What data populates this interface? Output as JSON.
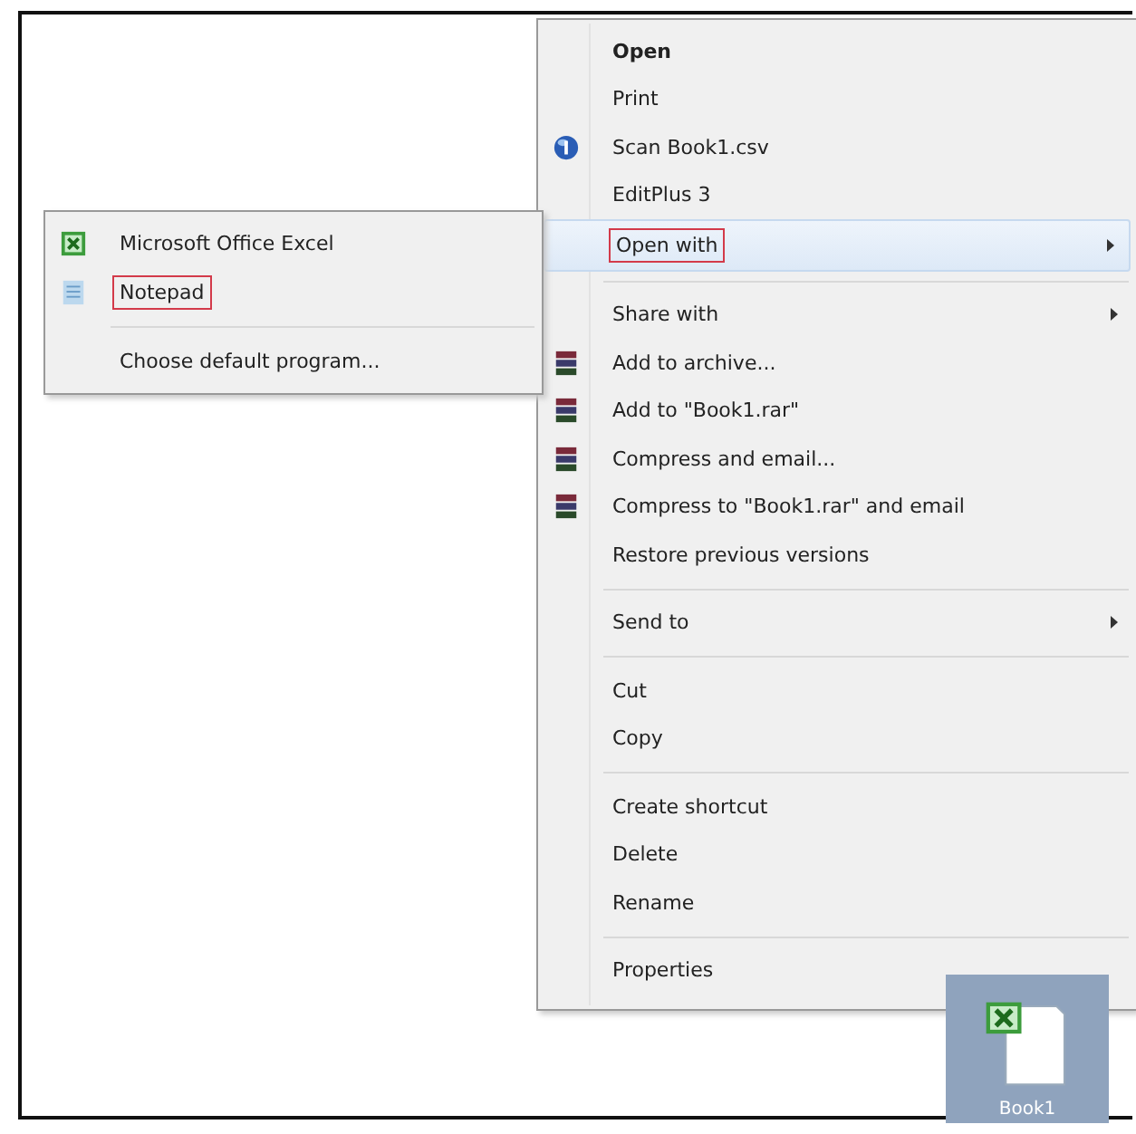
{
  "context_menu": {
    "items": [
      {
        "kind": "plain",
        "label": "Open",
        "bold": true
      },
      {
        "kind": "plain",
        "label": "Print"
      },
      {
        "kind": "scan",
        "label": "Scan Book1.csv"
      },
      {
        "kind": "plain",
        "label": "EditPlus 3"
      },
      {
        "kind": "plain",
        "label": "Open with",
        "submenu": true,
        "selected": true,
        "outlined": true
      },
      {
        "kind": "separator"
      },
      {
        "kind": "plain",
        "label": "Share with",
        "submenu": true
      },
      {
        "kind": "archive",
        "label": "Add to archive..."
      },
      {
        "kind": "archive",
        "label": "Add to \"Book1.rar\""
      },
      {
        "kind": "archive",
        "label": "Compress and email..."
      },
      {
        "kind": "archive",
        "label": "Compress to \"Book1.rar\" and email"
      },
      {
        "kind": "plain",
        "label": "Restore previous versions"
      },
      {
        "kind": "separator"
      },
      {
        "kind": "plain",
        "label": "Send to",
        "submenu": true
      },
      {
        "kind": "separator"
      },
      {
        "kind": "plain",
        "label": "Cut"
      },
      {
        "kind": "plain",
        "label": "Copy"
      },
      {
        "kind": "separator"
      },
      {
        "kind": "plain",
        "label": "Create shortcut"
      },
      {
        "kind": "plain",
        "label": "Delete"
      },
      {
        "kind": "plain",
        "label": "Rename"
      },
      {
        "kind": "separator"
      },
      {
        "kind": "plain",
        "label": "Properties"
      }
    ]
  },
  "submenu": {
    "items": [
      {
        "kind": "excel",
        "label": "Microsoft Office Excel"
      },
      {
        "kind": "notepad",
        "label": "Notepad",
        "outlined": true
      },
      {
        "kind": "separator"
      },
      {
        "kind": "plain",
        "label": "Choose default program..."
      }
    ]
  },
  "desktop_file": {
    "name": "Book1",
    "selected": true
  }
}
